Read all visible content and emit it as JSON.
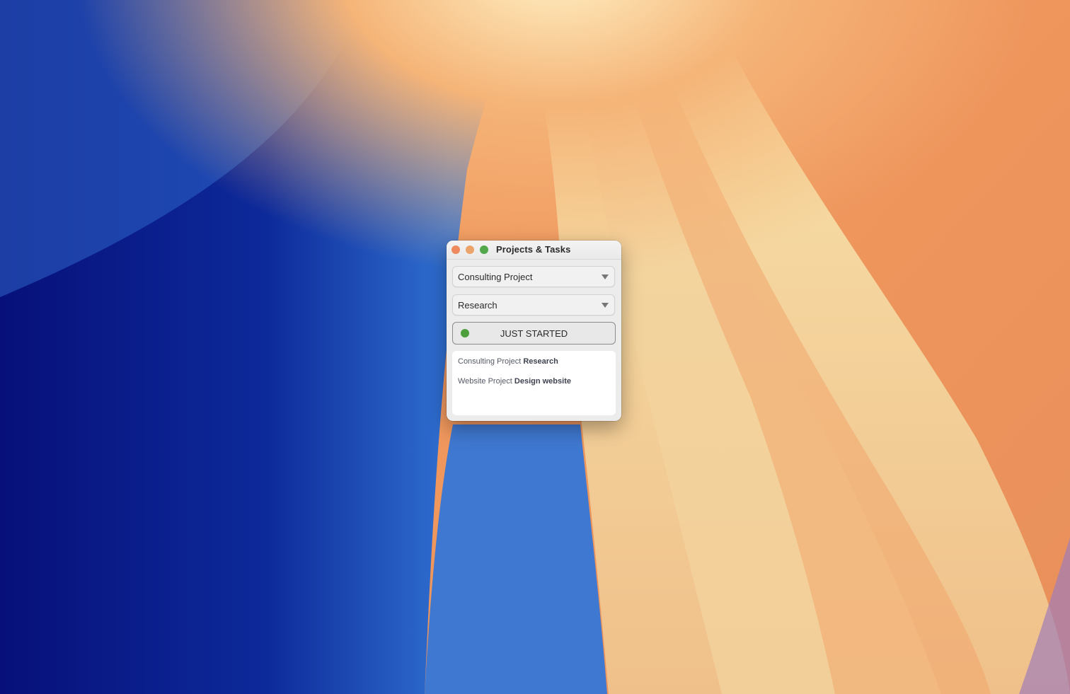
{
  "colors": {
    "close": "#ee8a5d",
    "minimize": "#eda46b",
    "zoom": "#52a84a",
    "status_dot": "#4e9e3c"
  },
  "window": {
    "title": "Projects & Tasks"
  },
  "project_select": {
    "value": "Consulting Project"
  },
  "task_select": {
    "value": "Research"
  },
  "status_button": {
    "label": "JUST STARTED"
  },
  "entries": [
    {
      "project": "Consulting Project",
      "task": "Research"
    },
    {
      "project": "Website Project",
      "task": "Design website"
    }
  ]
}
